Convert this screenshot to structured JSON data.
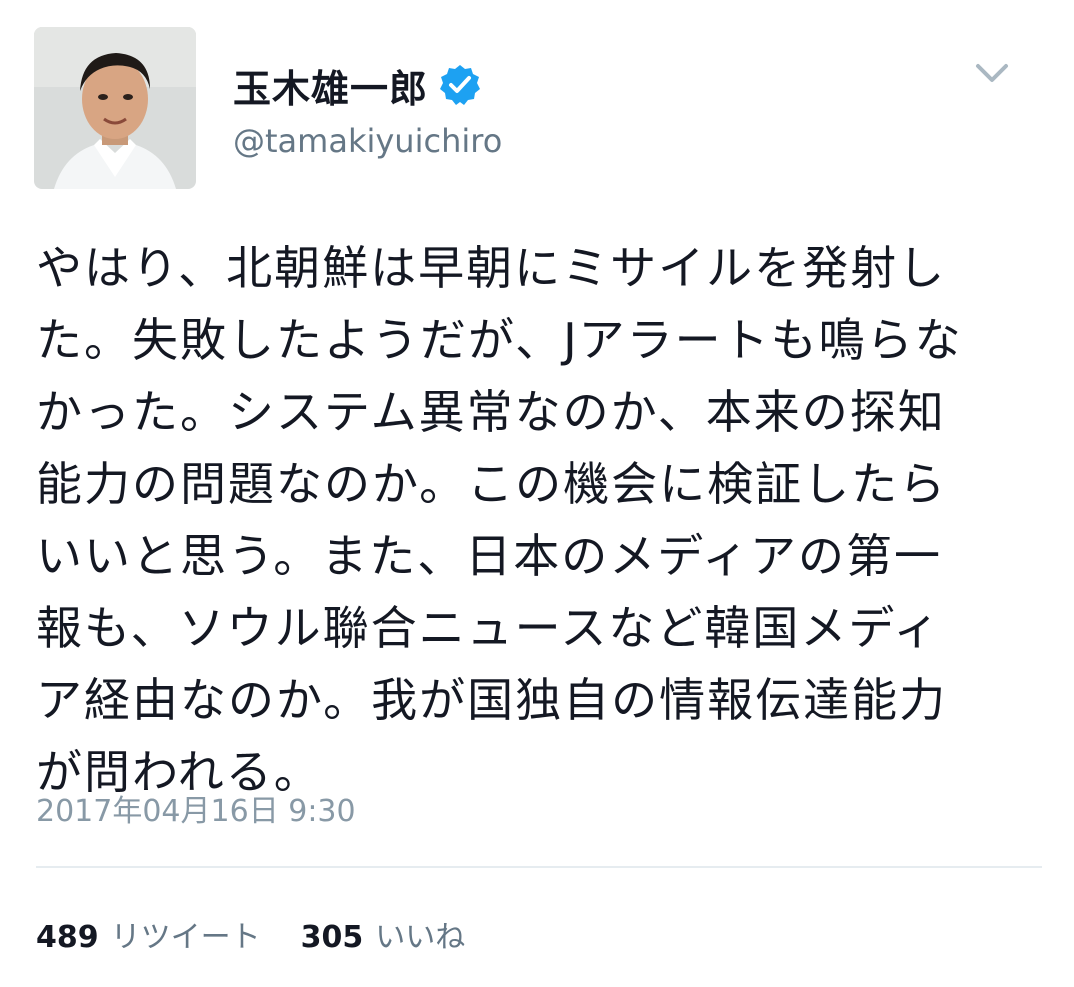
{
  "user": {
    "display_name": "玉木雄一郎",
    "handle": "@tamakiyuichiro",
    "verified": true,
    "avatar_icon": "profile-photo"
  },
  "tweet": {
    "lines": [
      "やはり、北朝鮮は早朝にミサイルを発射し",
      "た。失敗したようだが、Jアラートも鳴らな",
      "かった。システム異常なのか、本来の探知",
      "能力の問題なのか。この機会に検証したら",
      "いいと思う。また、日本のメディアの第一",
      "報も、ソウル聯合ニュースなど韓国メディ",
      "ア経由なのか。我が国独自の情報伝達能力",
      "が問われる。"
    ],
    "timestamp": "2017年04月16日 9:30"
  },
  "stats": {
    "retweets_count": "489",
    "retweets_label": "リツイート",
    "likes_count": "305",
    "likes_label": "いいね"
  },
  "colors": {
    "verified_blue": "#1da1f2",
    "secondary_text": "#657786",
    "timestamp_text": "#8899a6",
    "divider": "#e6ecf0"
  },
  "icons": {
    "verified": "verified-badge-icon",
    "caret": "chevron-down-icon"
  }
}
